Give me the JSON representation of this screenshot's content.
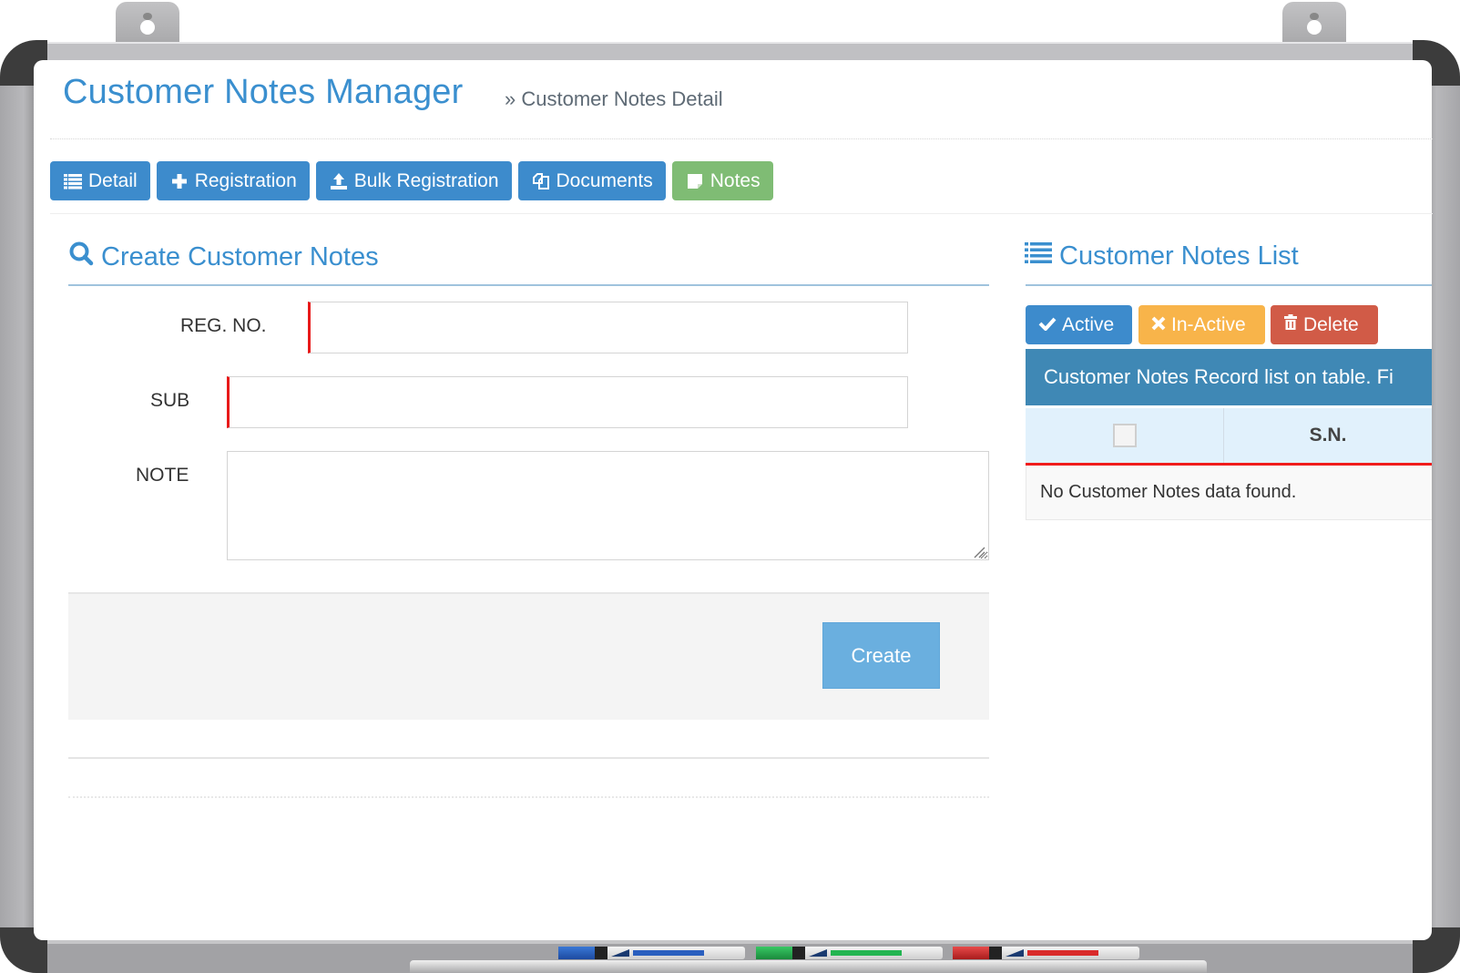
{
  "page": {
    "title": "Customer Notes Manager",
    "breadcrumb": "» Customer Notes Detail"
  },
  "tabs": [
    {
      "label": "Detail",
      "icon": "list-icon",
      "color": "#3d8bcc"
    },
    {
      "label": "Registration",
      "icon": "plus-icon",
      "color": "#3d8bcc"
    },
    {
      "label": "Bulk Registration",
      "icon": "upload-icon",
      "color": "#3d8bcc"
    },
    {
      "label": "Documents",
      "icon": "documents-icon",
      "color": "#3d8bcc"
    },
    {
      "label": "Notes",
      "icon": "sticky-note-icon",
      "color": "#7fbc74",
      "active": true
    }
  ],
  "create_form": {
    "title": "Create Customer Notes",
    "icon": "search-icon",
    "fields": [
      {
        "label": "REG. NO.",
        "value": "",
        "placeholder": "",
        "required": true
      },
      {
        "label": "SUB",
        "value": "",
        "placeholder": "",
        "required": true
      },
      {
        "label": "NOTE",
        "value": "",
        "placeholder": "",
        "type": "textarea"
      }
    ],
    "submit_label": "Create"
  },
  "notes_list": {
    "title": "Customer Notes List",
    "icon": "list-icon",
    "actions": [
      {
        "label": "Active",
        "icon": "check-icon",
        "color": "#3d8bcc"
      },
      {
        "label": "In-Active",
        "icon": "times-icon",
        "color": "#f8b44a"
      },
      {
        "label": "Delete",
        "icon": "trash-icon",
        "color": "#d15b47"
      }
    ],
    "caption": "Customer Notes Record list on table. Fi",
    "columns": [
      "",
      "S.N."
    ],
    "empty_message": "No Customer Notes data found."
  },
  "colors": {
    "accent": "#3a8fcf",
    "required_marker": "#e81a1a",
    "board_frame": "#c0c0c3"
  },
  "markers": [
    {
      "color": "blue",
      "hex": "#2a5fbf"
    },
    {
      "color": "green",
      "hex": "#23b551"
    },
    {
      "color": "red",
      "hex": "#d92b2b"
    }
  ]
}
